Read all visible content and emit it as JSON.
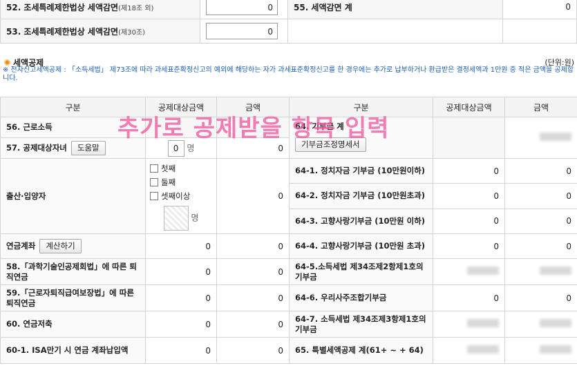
{
  "top_rows": [
    {
      "l_label": "52. 조세특례제한법상 세액감면",
      "l_small": "(제18조 외)",
      "l_value": "0",
      "r_label": "55. 세액감면 계",
      "r_value": "0"
    },
    {
      "l_label": "53. 조세특례제한법상 세액감면",
      "l_small": "(제30조)",
      "l_value": "0",
      "r_label": "",
      "r_value": ""
    }
  ],
  "section": {
    "title": "세액공제",
    "unit": "(단위:원)",
    "note": "※ 전자신고세액공제 : 「소득세법」 제73조에 따라 과세표준확정신고의 예외에 해당하는 자가 과세표준확정신고를 한 경우에는 추가로 납부하거나 환급받은 결정세액과 1만원 중 적은 금액을 공제합니다."
  },
  "headers": [
    "구분",
    "공제대상금액",
    "금액",
    "구분",
    "공제대상금액",
    "금액"
  ],
  "overlay": "추가로 공제받을 항목 입력",
  "left": {
    "r56": {
      "label": "56. 근로소득"
    },
    "r57": {
      "label": "57. 공제대상자녀",
      "btn": "도움말",
      "count": "0",
      "unit": "명",
      "amount": "0"
    },
    "birth": {
      "label": "출산·입양자",
      "opts": [
        "첫째",
        "둘째",
        "셋째이상"
      ],
      "unit": "명",
      "amount": "0"
    },
    "pension": {
      "label": "연금계좌",
      "btn": "계산하기",
      "base": "0",
      "amount": "0"
    },
    "r58": {
      "label": "58.「과학기술인공제회법」에 따른 퇴직연금",
      "base": "0",
      "amount": "0"
    },
    "r59": {
      "label": "59.「근로자퇴직급여보장법」에 따른 퇴직연금",
      "base": "0",
      "amount": "0"
    },
    "r60": {
      "label": "60. 연금저축",
      "base": "0",
      "amount": "0"
    },
    "r601": {
      "label": "60-1. ISA만기 시 연금 계좌납입액",
      "base": "0",
      "amount": "0"
    }
  },
  "right": {
    "r64": {
      "label": "64. 기부금 계",
      "btn": "기부금조정명세서"
    },
    "r641": {
      "label": "64-1. 정치자금 기부금 (10만원이하)",
      "base": "0",
      "amount": "0"
    },
    "r642": {
      "label": "64-2. 정치자금 기부금 (10만원초과)",
      "base": "0",
      "amount": "0"
    },
    "r643": {
      "label": "64-3. 고향사랑기부금 (10만원 이하)",
      "base": "0",
      "amount": "0"
    },
    "r644": {
      "label": "64-4. 고향사랑기부금 (10만원 초과)",
      "base": "0",
      "amount": "0"
    },
    "r645": {
      "label": "64-5.소득세법 제34조제2항제1호의 기부금"
    },
    "r646": {
      "label": "64-6. 우리사주조합기부금",
      "base": "0",
      "amount": "0"
    },
    "r647": {
      "label": "64-7. 소득세법 제34조제3항제1호의 기부금"
    },
    "r65": {
      "label": "65. 특별세액공제 계(61+ ~ + 64)"
    }
  }
}
